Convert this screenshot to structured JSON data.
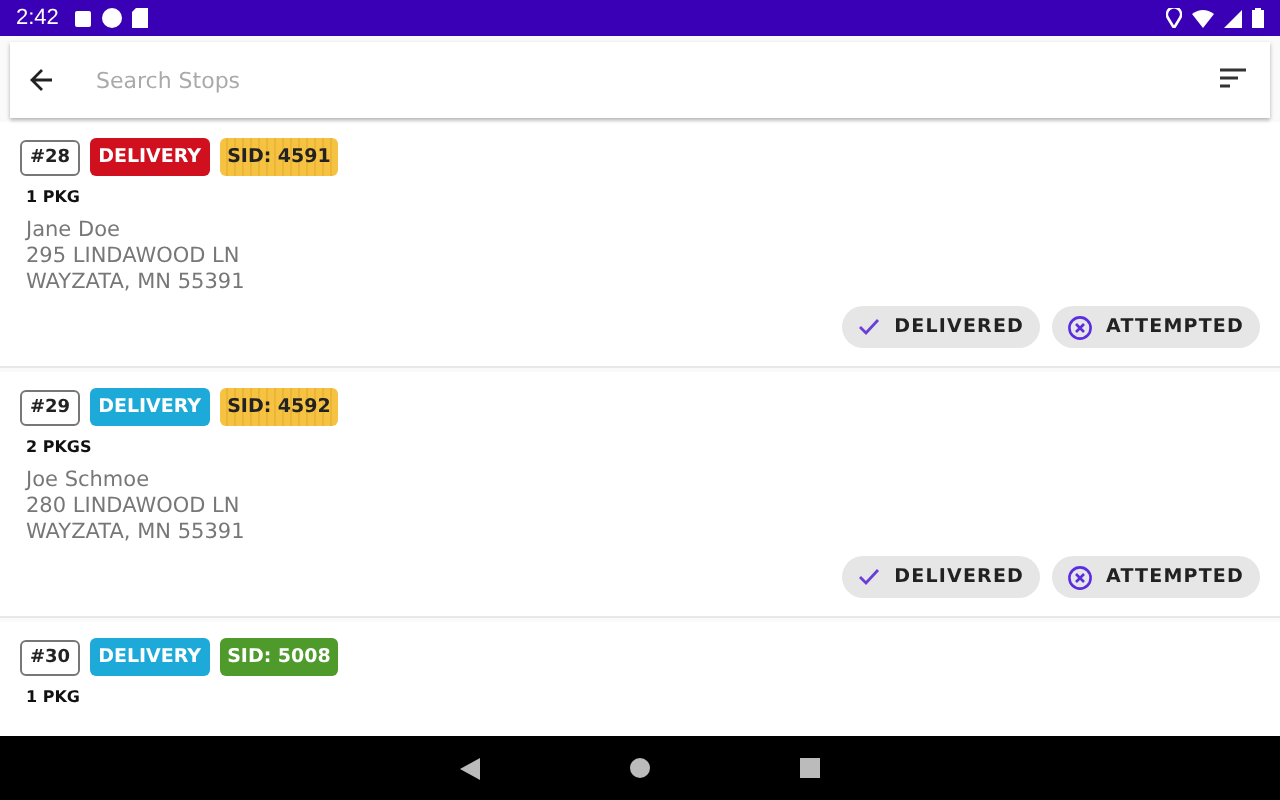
{
  "status_bar": {
    "time": "2:42"
  },
  "search": {
    "placeholder": "Search Stops"
  },
  "stops": [
    {
      "number": "#28",
      "type": {
        "label": "DELIVERY",
        "color": "#d0101f"
      },
      "sid": {
        "label": "SID: 4591",
        "color": "#f5c242",
        "striped": true
      },
      "packages": "1 PKG",
      "name": "Jane Doe",
      "address": [
        "295 LINDAWOOD LN",
        "WAYZATA, MN 55391"
      ],
      "actions": [
        {
          "kind": "check",
          "label": "DELIVERED"
        },
        {
          "kind": "cross",
          "label": "ATTEMPTED"
        }
      ]
    },
    {
      "number": "#29",
      "type": {
        "label": "DELIVERY",
        "color": "#1eaad8"
      },
      "sid": {
        "label": "SID: 4592",
        "color": "#f5c242",
        "striped": true
      },
      "packages": "2 PKGS",
      "name": "Joe Schmoe",
      "address": [
        "280 LINDAWOOD LN",
        "WAYZATA, MN 55391"
      ],
      "actions": [
        {
          "kind": "check",
          "label": "DELIVERED"
        },
        {
          "kind": "cross",
          "label": "ATTEMPTED"
        }
      ]
    },
    {
      "number": "#30",
      "type": {
        "label": "DELIVERY",
        "color": "#1eaad8"
      },
      "sid": {
        "label": "SID: 5008",
        "color": "#4e9a2a",
        "striped": false
      },
      "packages": "1 PKG"
    }
  ]
}
